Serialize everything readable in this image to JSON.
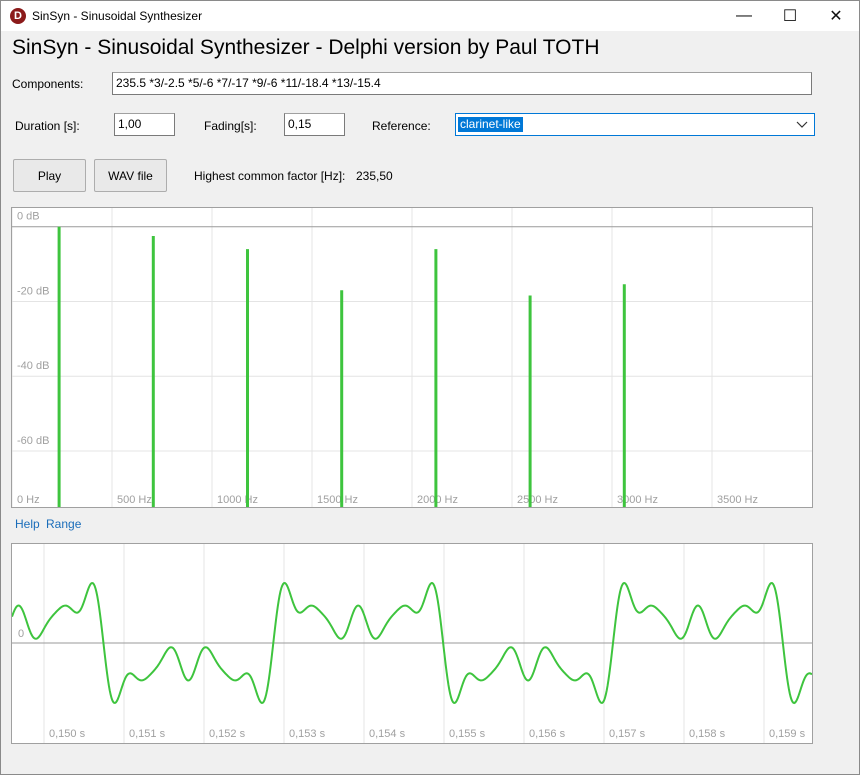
{
  "window": {
    "title": "SinSyn - Sinusoidal Synthesizer",
    "minimize_glyph": "—",
    "maximize_glyph": "☐",
    "close_glyph": "✕",
    "icon_letter": "D"
  },
  "heading": "SinSyn - Sinusoidal Synthesizer - Delphi version by Paul TOTH",
  "components": {
    "label": "Components:",
    "value": "235.5 *3/-2.5 *5/-6 *7/-17 *9/-6 *11/-18.4 *13/-15.4"
  },
  "duration": {
    "label": "Duration [s]:",
    "value": "1,00"
  },
  "fading": {
    "label": "Fading[s]:",
    "value": "0,15"
  },
  "reference": {
    "label": "Reference:",
    "value": "clarinet-like"
  },
  "buttons": {
    "play": "Play",
    "wav": "WAV file"
  },
  "hcf": {
    "label": "Highest common factor [Hz]:",
    "value": "235,50"
  },
  "links": {
    "help": "Help",
    "range": "Range"
  },
  "spectrum": {
    "y_labels": [
      "0 dB",
      "-20 dB",
      "-40 dB",
      "-60 dB"
    ],
    "x_labels": [
      "0 Hz",
      "500 Hz",
      "1000 Hz",
      "1500 Hz",
      "2000 Hz",
      "2500 Hz",
      "3000 Hz",
      "3500 Hz"
    ],
    "line_color": "#3ec43e"
  },
  "waveform": {
    "zero_label": "0",
    "x_labels": [
      "0,150 s",
      "0,151 s",
      "0,152 s",
      "0,153 s",
      "0,154 s",
      "0,155 s",
      "0,156 s",
      "0,157 s",
      "0,158 s",
      "0,159 s"
    ],
    "line_color": "#3ec43e"
  },
  "chart_data": [
    {
      "type": "bar",
      "x": [
        235.5,
        706.5,
        1177.5,
        1648.5,
        2119.5,
        2590.5,
        3061.5
      ],
      "values": [
        0,
        -2.5,
        -6,
        -17,
        -6,
        -18.4,
        -15.4
      ],
      "xlim": [
        0,
        4000
      ],
      "ylim": [
        -75,
        5
      ],
      "y_ticks": [
        "0 dB",
        "-20 dB",
        "-40 dB",
        "-60 dB"
      ],
      "x_ticks": [
        "0 Hz",
        "500 Hz",
        "1000 Hz",
        "1500 Hz",
        "2000 Hz",
        "2500 Hz",
        "3000 Hz",
        "3500 Hz"
      ],
      "grid": true
    },
    {
      "type": "line",
      "fundamental_hz": 235.5,
      "components_db": [
        0,
        -2.5,
        -6,
        -17,
        -6,
        -18.4,
        -15.4
      ],
      "harmonics": [
        1,
        3,
        5,
        7,
        9,
        11,
        13
      ],
      "xlim": [
        0.1496,
        0.1596
      ],
      "x_ticks": [
        "0,150 s",
        "0,151 s",
        "0,152 s",
        "0,153 s",
        "0,154 s",
        "0,155 s",
        "0,156 s",
        "0,157 s",
        "0,158 s",
        "0,159 s"
      ],
      "grid": true
    }
  ]
}
